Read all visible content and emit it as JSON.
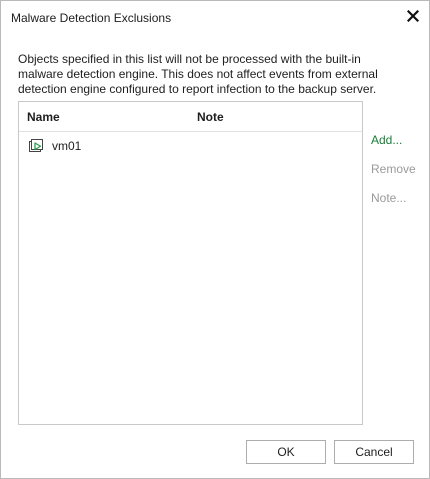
{
  "dialog": {
    "title": "Malware Detection Exclusions",
    "close_icon": "close-icon",
    "description": "Objects specified in this list will not be processed with the built-in malware detection engine. This does not affect events from external detection engine configured to report infection to the backup server."
  },
  "table": {
    "columns": [
      "Name",
      "Note"
    ],
    "rows": [
      {
        "name": "vm01",
        "note": "",
        "icon": "vm-icon"
      }
    ]
  },
  "actions": {
    "add": "Add...",
    "remove": "Remove",
    "note": "Note..."
  },
  "buttons": {
    "ok": "OK",
    "cancel": "Cancel"
  },
  "colors": {
    "link_green": "#1a7f37",
    "disabled_gray": "#9a9a9a",
    "vm_icon_green": "#2e9e4f"
  }
}
